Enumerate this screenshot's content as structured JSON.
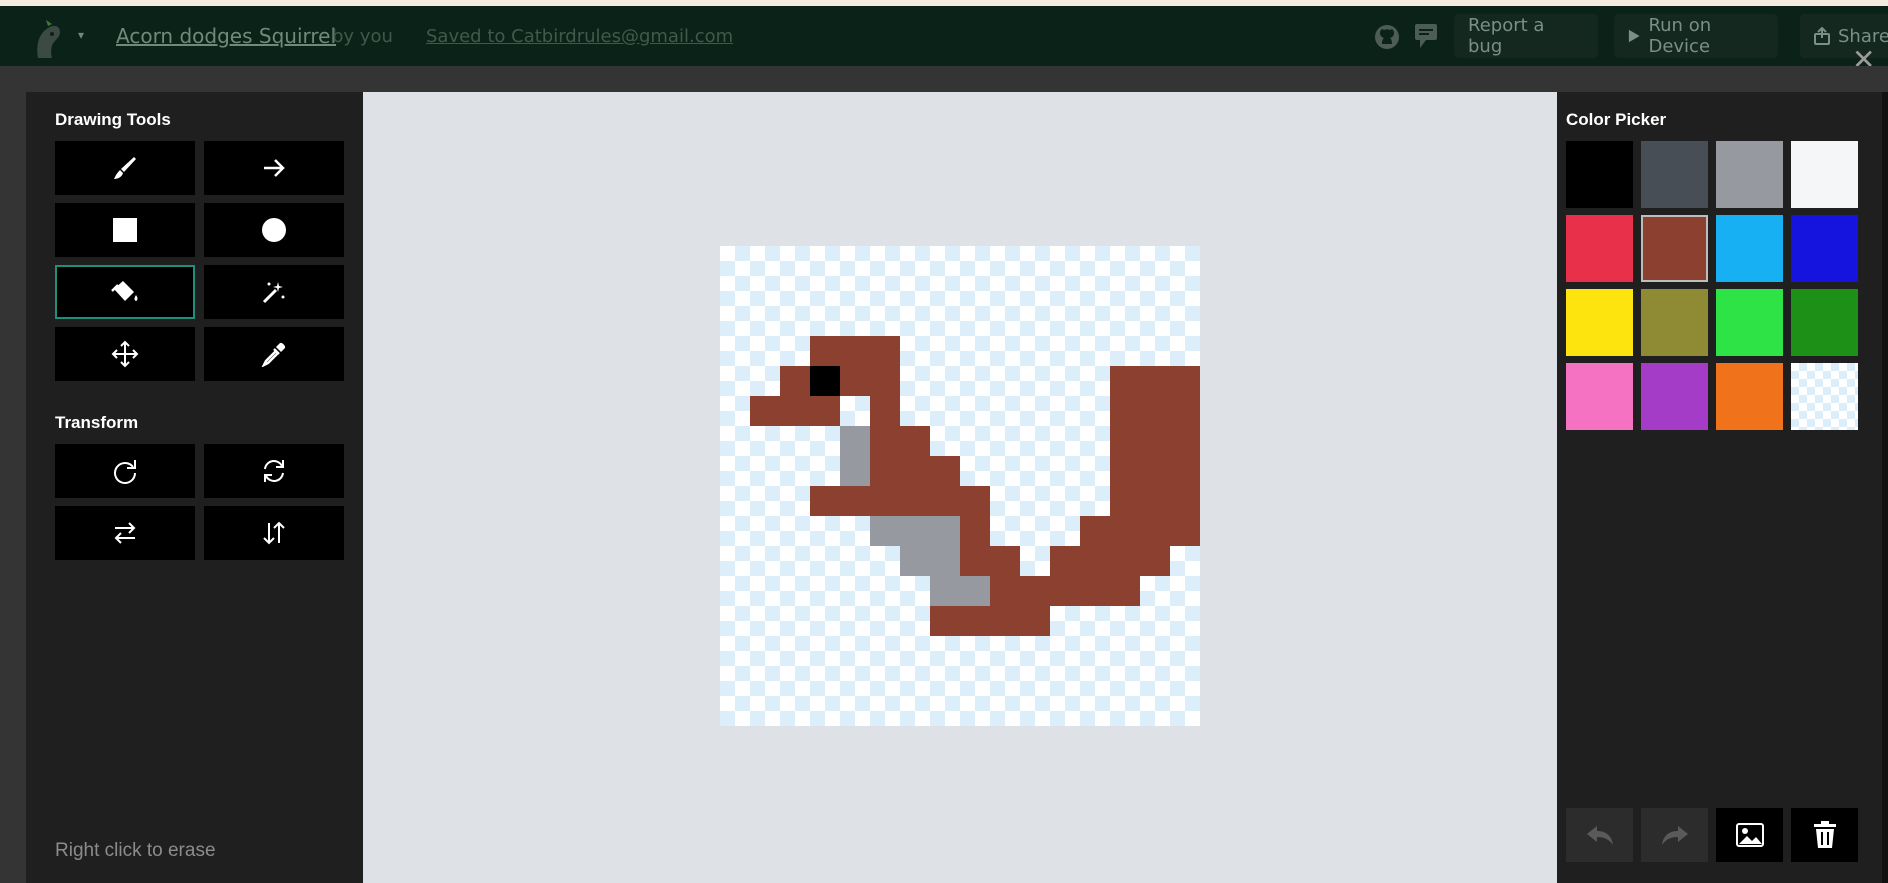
{
  "topbar": {
    "project_title": "Acorn dodges Squirrel",
    "project_by": "by you",
    "saved_text": "Saved to Catbirdrules@gmail.com",
    "report_bug_label": "Report a bug",
    "run_device_label": "Run on Device",
    "share_label": "Share",
    "close_symbol": "✕"
  },
  "left_panel": {
    "drawing_tools_title": "Drawing Tools",
    "drawing_tools": [
      {
        "icon": "pencil-icon",
        "label": "Draw"
      },
      {
        "icon": "arrow-right-icon",
        "label": "Line"
      },
      {
        "icon": "square-icon",
        "label": "Rectangle"
      },
      {
        "icon": "circle-icon",
        "label": "Circle"
      },
      {
        "icon": "paint-bucket-icon",
        "label": "Fill",
        "active": true
      },
      {
        "icon": "magic-wand-icon",
        "label": "Magic wand"
      },
      {
        "icon": "move-icon",
        "label": "Move"
      },
      {
        "icon": "eyedropper-icon",
        "label": "Color picker"
      }
    ],
    "transform_title": "Transform",
    "transform_tools": [
      {
        "icon": "rotate-cw-icon"
      },
      {
        "icon": "rotate-both-icon"
      },
      {
        "icon": "flip-horizontal-icon"
      },
      {
        "icon": "flip-vertical-icon"
      }
    ],
    "hint": "Right click to erase"
  },
  "canvas": {
    "grid_size": 16,
    "pixels": {
      "brown": "#8b4030",
      "gray": "#969aa0",
      "black": "#000000",
      "brown_cells": [
        [
          3,
          3
        ],
        [
          4,
          3
        ],
        [
          5,
          3
        ],
        [
          2,
          4
        ],
        [
          4,
          4
        ],
        [
          5,
          4
        ],
        [
          13,
          4
        ],
        [
          14,
          4
        ],
        [
          15,
          4
        ],
        [
          1,
          5
        ],
        [
          2,
          5
        ],
        [
          3,
          5
        ],
        [
          5,
          5
        ],
        [
          13,
          5
        ],
        [
          14,
          5
        ],
        [
          15,
          5
        ],
        [
          5,
          6
        ],
        [
          6,
          6
        ],
        [
          13,
          6
        ],
        [
          14,
          6
        ],
        [
          15,
          6
        ],
        [
          5,
          7
        ],
        [
          6,
          7
        ],
        [
          7,
          7
        ],
        [
          13,
          7
        ],
        [
          14,
          7
        ],
        [
          15,
          7
        ],
        [
          3,
          8
        ],
        [
          4,
          8
        ],
        [
          5,
          8
        ],
        [
          6,
          8
        ],
        [
          7,
          8
        ],
        [
          8,
          8
        ],
        [
          13,
          8
        ],
        [
          14,
          8
        ],
        [
          15,
          8
        ],
        [
          8,
          9
        ],
        [
          12,
          9
        ],
        [
          13,
          9
        ],
        [
          14,
          9
        ],
        [
          15,
          9
        ],
        [
          8,
          10
        ],
        [
          9,
          10
        ],
        [
          11,
          10
        ],
        [
          12,
          10
        ],
        [
          13,
          10
        ],
        [
          14,
          10
        ],
        [
          9,
          11
        ],
        [
          10,
          11
        ],
        [
          11,
          11
        ],
        [
          12,
          11
        ],
        [
          13,
          11
        ],
        [
          7,
          12
        ],
        [
          8,
          12
        ],
        [
          9,
          12
        ],
        [
          10,
          12
        ]
      ],
      "gray_cells": [
        [
          4,
          6
        ],
        [
          4,
          7
        ],
        [
          5,
          9
        ],
        [
          6,
          9
        ],
        [
          7,
          9
        ],
        [
          6,
          10
        ],
        [
          7,
          10
        ],
        [
          7,
          11
        ],
        [
          8,
          11
        ]
      ],
      "black_cells": [
        [
          3,
          4
        ]
      ]
    }
  },
  "right_panel": {
    "color_picker_title": "Color Picker",
    "swatches": [
      {
        "name": "black",
        "color": "#000000"
      },
      {
        "name": "dark-gray",
        "color": "#484e55"
      },
      {
        "name": "gray",
        "color": "#969aa0"
      },
      {
        "name": "white",
        "color": "#f5f6f8"
      },
      {
        "name": "red",
        "color": "#e8304a"
      },
      {
        "name": "brown",
        "color": "#8b4030",
        "selected": true
      },
      {
        "name": "sky-blue",
        "color": "#17b0f3"
      },
      {
        "name": "blue",
        "color": "#1414de"
      },
      {
        "name": "yellow",
        "color": "#fde40f"
      },
      {
        "name": "olive",
        "color": "#8f8a34"
      },
      {
        "name": "green",
        "color": "#2ee346"
      },
      {
        "name": "dark-green",
        "color": "#1c9017"
      },
      {
        "name": "pink",
        "color": "#f472c1"
      },
      {
        "name": "purple",
        "color": "#a53cc8"
      },
      {
        "name": "orange",
        "color": "#f0731c"
      },
      {
        "name": "transparent",
        "color": "transparent"
      }
    ],
    "actions": [
      {
        "icon": "undo-icon"
      },
      {
        "icon": "redo-icon"
      },
      {
        "icon": "image-icon"
      },
      {
        "icon": "trash-icon"
      }
    ]
  }
}
